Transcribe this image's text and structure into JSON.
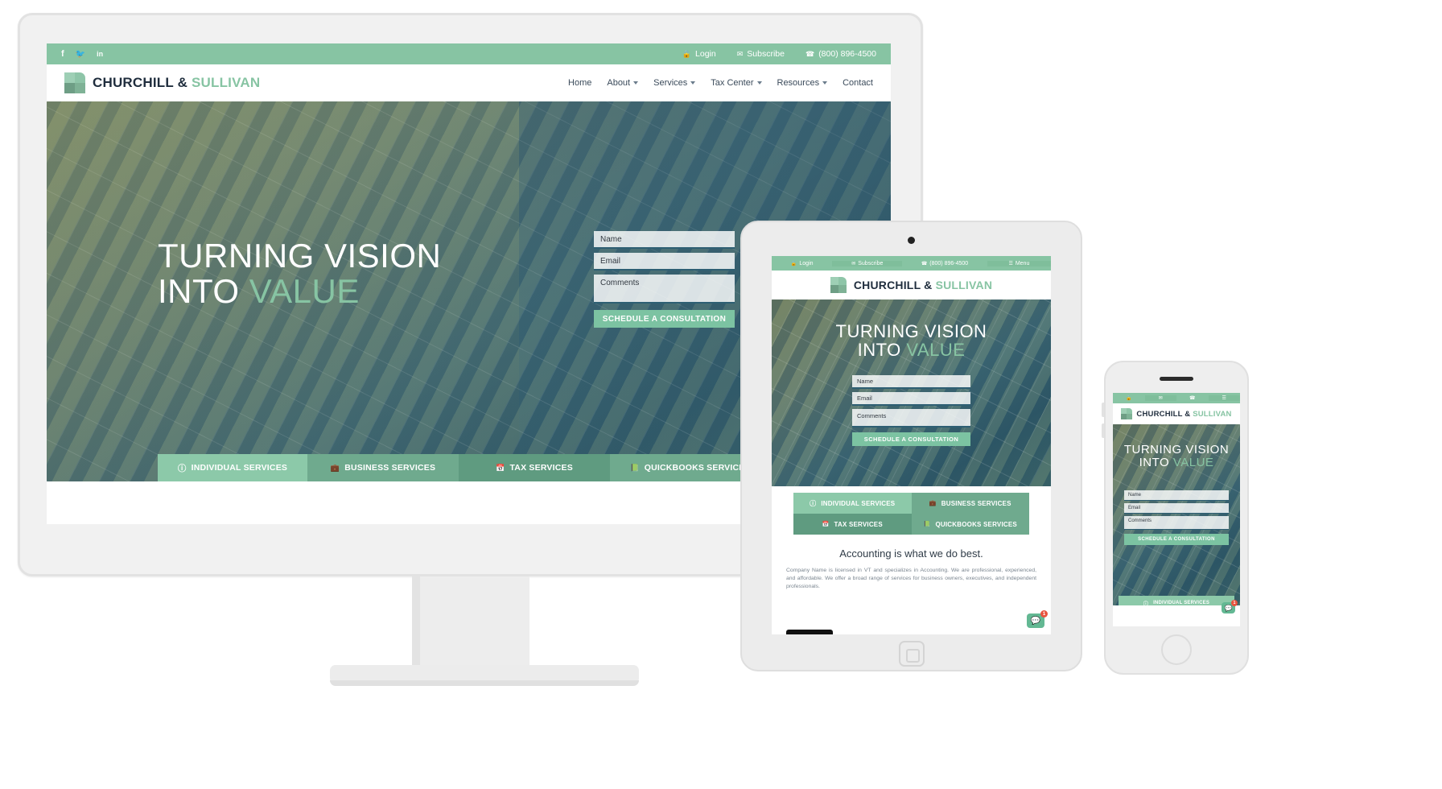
{
  "brand": {
    "name_bold": "CHURCHILL &",
    "name_light": "SULLIVAN",
    "accent_color": "#87c4a3",
    "dark_color": "#1f2d3d"
  },
  "topbar": {
    "social": [
      {
        "name": "facebook-icon",
        "glyph": "f"
      },
      {
        "name": "twitter-icon",
        "glyph": "🐦"
      },
      {
        "name": "linkedin-icon",
        "glyph": "in"
      }
    ],
    "login": "Login",
    "subscribe": "Subscribe",
    "phone": "(800) 896-4500",
    "menu": "Menu",
    "lock_icon": "🔒",
    "mail_icon": "✉",
    "phone_icon": "☎",
    "menu_icon": "☰"
  },
  "nav": {
    "items": [
      {
        "label": "Home",
        "dropdown": false
      },
      {
        "label": "About",
        "dropdown": true
      },
      {
        "label": "Services",
        "dropdown": true
      },
      {
        "label": "Tax Center",
        "dropdown": true
      },
      {
        "label": "Resources",
        "dropdown": true
      },
      {
        "label": "Contact",
        "dropdown": false
      }
    ]
  },
  "hero": {
    "line1": "TURNING VISION",
    "line2_pre": "INTO ",
    "line2_accent": "VALUE"
  },
  "form": {
    "name_placeholder": "Name",
    "email_placeholder": "Email",
    "comments_placeholder": "Comments",
    "submit_label": "SCHEDULE A CONSULTATION"
  },
  "services": [
    {
      "label": "INDIVIDUAL SERVICES",
      "icon": "ⓘ",
      "icon_name": "person-circle-icon"
    },
    {
      "label": "BUSINESS SERVICES",
      "icon": "💼",
      "icon_name": "briefcase-icon"
    },
    {
      "label": "TAX SERVICES",
      "icon": "📅",
      "icon_name": "calendar-icon"
    },
    {
      "label": "QUICKBOOKS SERVICES",
      "icon": "📗",
      "icon_name": "book-icon"
    }
  ],
  "section": {
    "heading": "Accounting is what we do best.",
    "body": "Company Name is licensed in VT and specializes in Accounting. We are professional, experienced, and affordable. We offer a broad range of services for business owners, executives, and independent professionals."
  },
  "chat": {
    "icon": "💬",
    "badge": "1"
  }
}
